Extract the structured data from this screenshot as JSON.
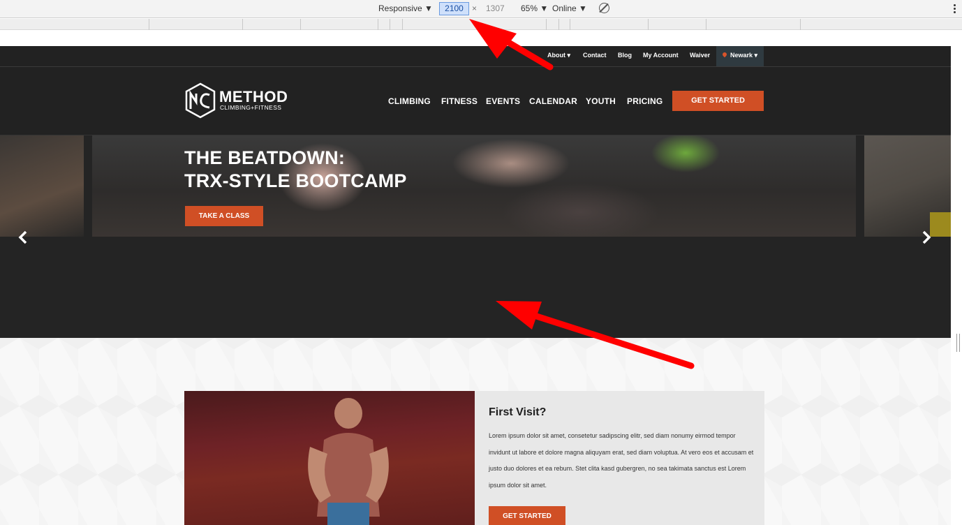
{
  "devtools": {
    "device": "Responsive ▼",
    "width": "2100",
    "times": "×",
    "height": "1307",
    "zoom": "65% ▼",
    "network": "Online ▼"
  },
  "site": {
    "topbar": {
      "links": [
        "About ▾",
        "Contact",
        "Blog",
        "My Account",
        "Waiver"
      ],
      "location": "Newark ▾"
    },
    "logo": {
      "word": "METHOD",
      "sub": "CLIMBING+FITNESS"
    },
    "nav": [
      "CLIMBING",
      "FITNESS",
      "EVENTS",
      "CALENDAR",
      "YOUTH",
      "PRICING"
    ],
    "cta": "GET STARTED",
    "hero": {
      "title_line1": "THE BEATDOWN:",
      "title_line2": "TRX-STYLE BOOTCAMP",
      "button": "TAKE A CLASS"
    },
    "first_visit": {
      "title": "First Visit?",
      "body": "Lorem ipsum dolor sit amet, consetetur sadipscing elitr, sed diam nonumy eirmod tempor invidunt ut labore et dolore magna aliquyam erat, sed diam voluptua. At vero eos et accusam et justo duo dolores et ea rebum. Stet clita kasd gubergren, no sea takimata sanctus est Lorem ipsum dolor sit amet.",
      "button": "GET STARTED"
    }
  },
  "colors": {
    "accent": "#d04f25",
    "dark": "#222222",
    "annotation": "#ff0000"
  }
}
